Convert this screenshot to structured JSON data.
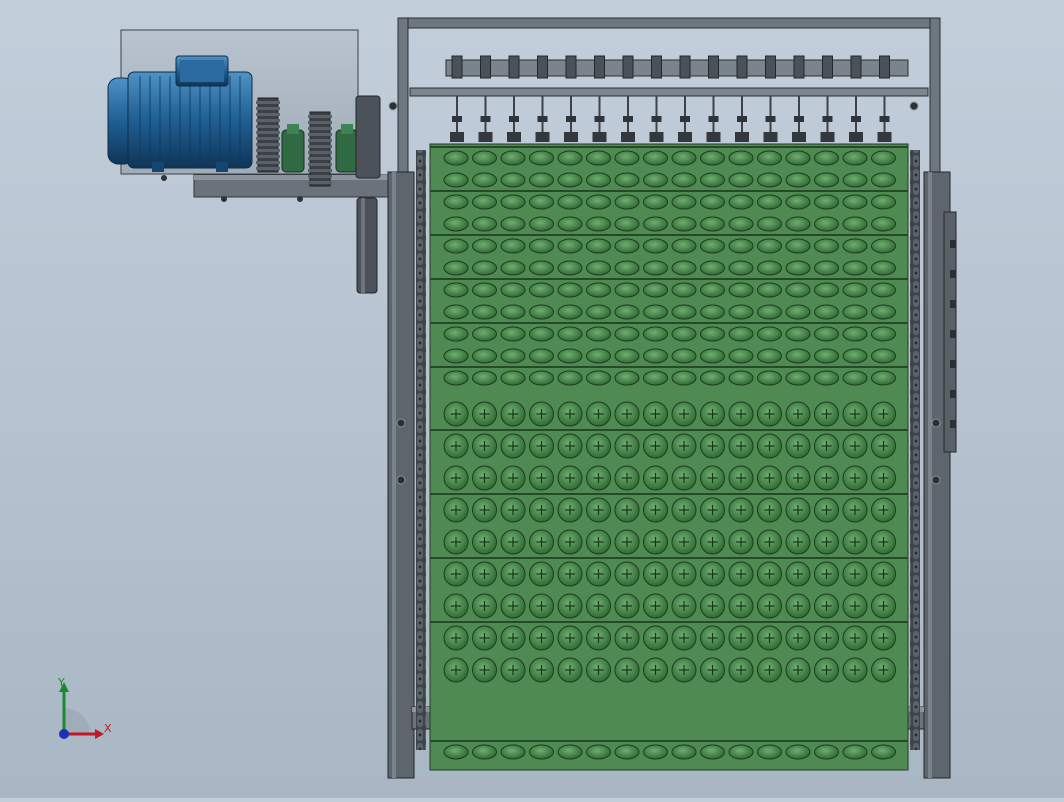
{
  "viewport": {
    "background_top": "#c3cedb",
    "background_bottom": "#a9b6c4"
  },
  "model": {
    "motor_color": "#1f5f93",
    "conveyor_color": "#4f8a52",
    "frame_color": "#505760",
    "guard_color": "#a8b4c0"
  },
  "triad": {
    "x_label": "X",
    "y_label": "Y",
    "x_color": "#c0182a",
    "y_color": "#1b8a2e",
    "z_color": "#1c2fb8"
  }
}
